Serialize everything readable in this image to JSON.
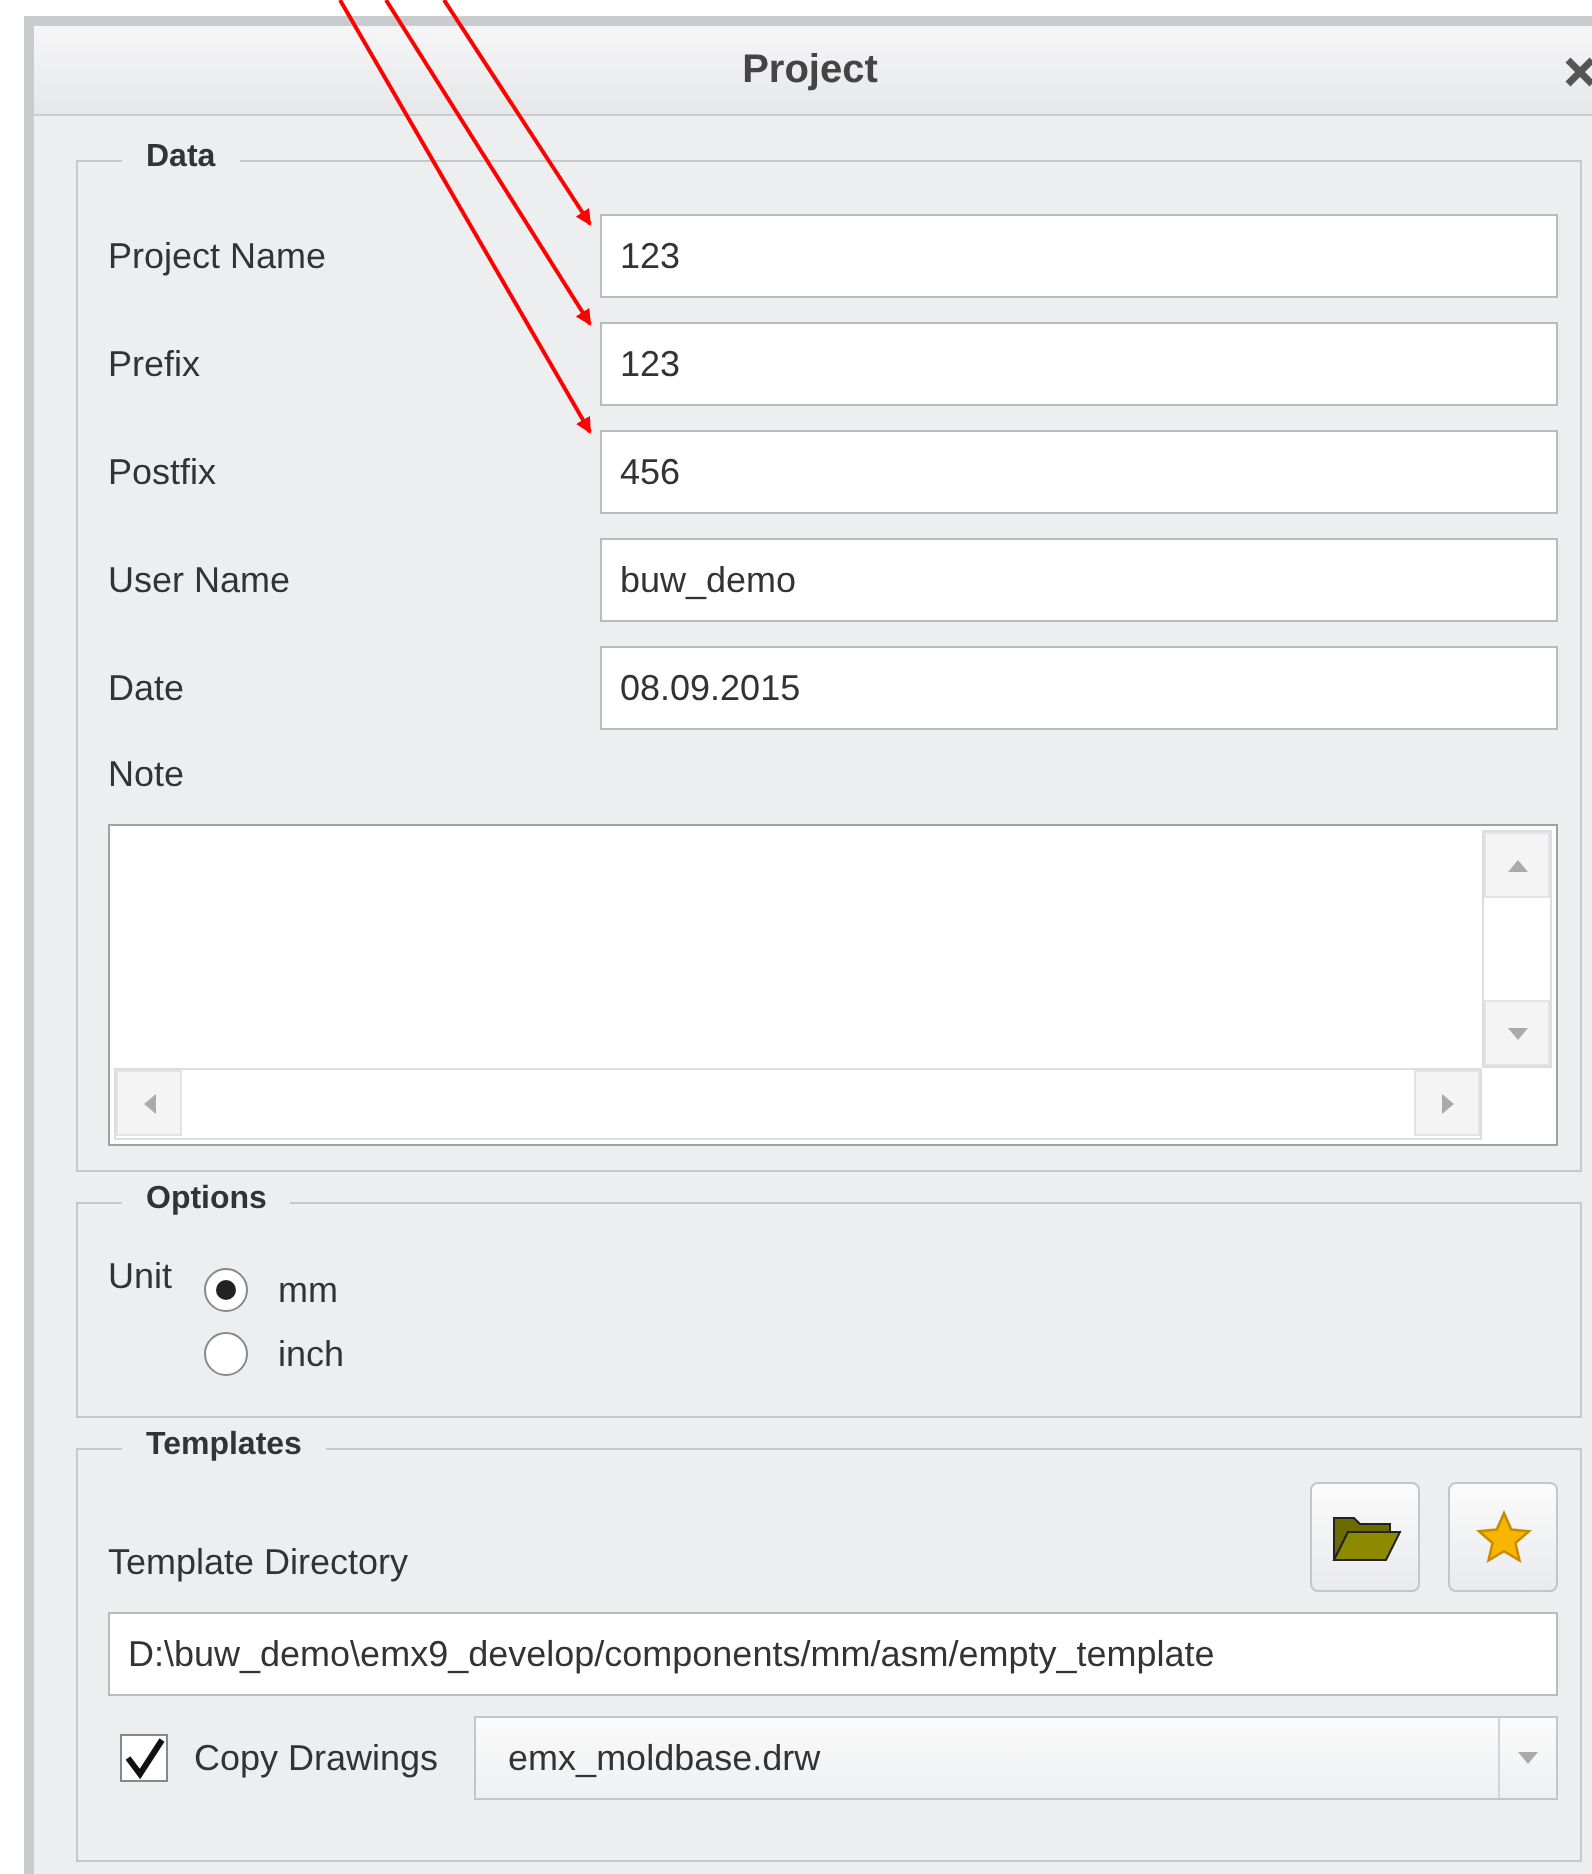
{
  "window": {
    "title": "Project"
  },
  "data_group": {
    "title": "Data",
    "fields": [
      {
        "label": "Project Name",
        "value": "123"
      },
      {
        "label": "Prefix",
        "value": "123"
      },
      {
        "label": "Postfix",
        "value": "456"
      },
      {
        "label": "User Name",
        "value": "buw_demo"
      },
      {
        "label": "Date",
        "value": "08.09.2015"
      }
    ],
    "note": {
      "label": "Note"
    }
  },
  "options_group": {
    "title": "Options",
    "unit": {
      "label": "Unit",
      "options": [
        {
          "label": "mm",
          "selected": true
        },
        {
          "label": "inch",
          "selected": false
        }
      ]
    }
  },
  "templates_group": {
    "title": "Templates",
    "directory_label": "Template Directory",
    "directory": "D:\\buw_demo\\emx9_develop/components/mm/asm/empty_template",
    "copy_drawings": {
      "label": "Copy Drawings",
      "checked": true
    },
    "drawing": "emx_moldbase.drw"
  }
}
